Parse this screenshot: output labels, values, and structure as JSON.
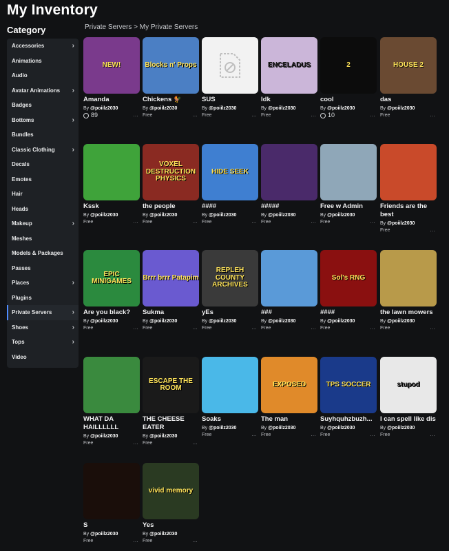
{
  "page_title": "My Inventory",
  "category_title": "Category",
  "breadcrumb": [
    "Private Servers",
    ">",
    "My Private Servers"
  ],
  "categories": [
    {
      "label": "Accessories",
      "chevron": true
    },
    {
      "label": "Animations",
      "chevron": false
    },
    {
      "label": "Audio",
      "chevron": false
    },
    {
      "label": "Avatar Animations",
      "chevron": true
    },
    {
      "label": "Badges",
      "chevron": false
    },
    {
      "label": "Bottoms",
      "chevron": true
    },
    {
      "label": "Bundles",
      "chevron": false
    },
    {
      "label": "Classic Clothing",
      "chevron": true
    },
    {
      "label": "Decals",
      "chevron": false
    },
    {
      "label": "Emotes",
      "chevron": false
    },
    {
      "label": "Hair",
      "chevron": false
    },
    {
      "label": "Heads",
      "chevron": false
    },
    {
      "label": "Makeup",
      "chevron": true
    },
    {
      "label": "Meshes",
      "chevron": false
    },
    {
      "label": "Models & Packages",
      "chevron": false
    },
    {
      "label": "Passes",
      "chevron": false
    },
    {
      "label": "Places",
      "chevron": true
    },
    {
      "label": "Plugins",
      "chevron": false
    },
    {
      "label": "Private Servers",
      "chevron": true,
      "active": true
    },
    {
      "label": "Shoes",
      "chevron": true
    },
    {
      "label": "Tops",
      "chevron": true
    },
    {
      "label": "Video",
      "chevron": false
    }
  ],
  "by_prefix": "By",
  "creator": "@poiilz2030",
  "items": [
    {
      "name": "Amanda",
      "price": "89",
      "robux": true,
      "thumb_text": "NEW!",
      "bg": "#7a3a8c"
    },
    {
      "name": "Chickens 🐓",
      "price": "Free",
      "thumb_text": "Blocks n' Props",
      "bg": "#4b7fc4"
    },
    {
      "name": "SUS",
      "price": "Free",
      "thumb_text": "",
      "bg": "#f2f2f2",
      "placeholder": true
    },
    {
      "name": "Idk",
      "price": "Free",
      "thumb_text": "ENCELADUS",
      "bg": "#cbb6d9"
    },
    {
      "name": "cool",
      "price": "10",
      "robux": true,
      "thumb_text": "2",
      "bg": "#0c0c0c"
    },
    {
      "name": "das",
      "price": "Free",
      "thumb_text": "HOUSE 2",
      "bg": "#6a4a32"
    },
    {
      "name": "Kssk",
      "price": "Free",
      "thumb_text": "",
      "bg": "#3fa33a"
    },
    {
      "name": "the people",
      "price": "Free",
      "thumb_text": "VOXEL DESTRUCTION PHYSICS",
      "bg": "#8a2a22"
    },
    {
      "name": "####",
      "price": "Free",
      "thumb_text": "HIDE SEEK",
      "bg": "#3f7fd1"
    },
    {
      "name": "#####",
      "price": "Free",
      "thumb_text": "",
      "bg": "#4a2a6a"
    },
    {
      "name": "Free w Admin",
      "price": "Free",
      "thumb_text": "",
      "bg": "#8fa7b8"
    },
    {
      "name": "Friends are the best",
      "price": "Free",
      "thumb_text": "",
      "bg": "#c94a2a"
    },
    {
      "name": "Are you black?",
      "price": "Free",
      "thumb_text": "EPIC MINIGAMES",
      "bg": "#2b8a3e"
    },
    {
      "name": "Sukma",
      "price": "Free",
      "thumb_text": "Brrr brrr Patapim",
      "bg": "#6a5ad0"
    },
    {
      "name": "yEs",
      "price": "Free",
      "thumb_text": "REPLEH COUNTY ARCHIVES",
      "bg": "#3a3a3a"
    },
    {
      "name": "###",
      "price": "Free",
      "thumb_text": "",
      "bg": "#5a9ad8"
    },
    {
      "name": "####",
      "price": "Free",
      "thumb_text": "Sol's RNG",
      "bg": "#8a1010"
    },
    {
      "name": "the lawn mowers",
      "price": "Free",
      "thumb_text": "",
      "bg": "#b89a4a"
    },
    {
      "name": "WHAT DA HAILLLLLL",
      "price": "Free",
      "thumb_text": "",
      "bg": "#3a8a3e"
    },
    {
      "name": "THE CHEESE EATER",
      "price": "Free",
      "thumb_text": "ESCAPE THE ROOM",
      "bg": "#1a1a1a"
    },
    {
      "name": "Soaks",
      "price": "Free",
      "thumb_text": "",
      "bg": "#4ab8e8"
    },
    {
      "name": "The man",
      "price": "Free",
      "thumb_text": "EXPOSED",
      "bg": "#e08a2a"
    },
    {
      "name": "Suyhquhzbuzh...",
      "price": "Free",
      "thumb_text": "TPS SOCCER",
      "bg": "#1a3a8a"
    },
    {
      "name": "I can spell like dis",
      "price": "Free",
      "thumb_text": "stupod",
      "bg": "#e8e8e8"
    },
    {
      "name": "S",
      "price": "Free",
      "thumb_text": "",
      "bg": "#1a0e0a"
    },
    {
      "name": "Yes",
      "price": "Free",
      "thumb_text": "vivid memory",
      "bg": "#2a3a22"
    }
  ]
}
